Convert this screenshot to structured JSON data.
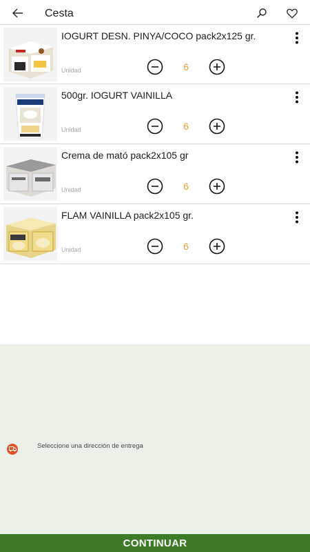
{
  "header": {
    "title": "Cesta",
    "back_icon": "arrow-left-icon",
    "search_icon": "search-icon",
    "favorites_icon": "heart-icon"
  },
  "cart": {
    "items": [
      {
        "name": "IOGURT DESN. PINYA/COCO pack2x125 gr.",
        "unit": "Unidad",
        "quantity": "6"
      },
      {
        "name": "500gr. IOGURT VAINILLA",
        "unit": "Unidad",
        "quantity": "6"
      },
      {
        "name": "Crema de mató pack2x105 gr",
        "unit": "Unidad",
        "quantity": "6"
      },
      {
        "name": "FLAM VAINILLA pack2x105 gr.",
        "unit": "Unidad",
        "quantity": "6"
      }
    ]
  },
  "delivery": {
    "prompt": "Seleccione una dirección de entrega",
    "icon": "delivery-truck-icon"
  },
  "footer": {
    "continue_label": "CONTINUAR"
  },
  "colors": {
    "accent_quantity": "#f39b2f",
    "continue_bg": "#3e7b28",
    "delivery_bg": "#ebf0e9",
    "delivery_icon_bg": "#e0532a"
  }
}
